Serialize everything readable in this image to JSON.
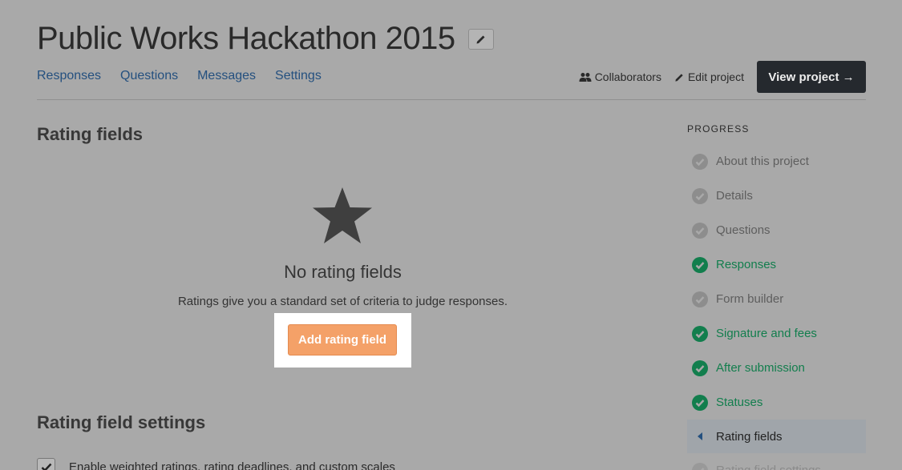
{
  "header": {
    "title": "Public Works Hackathon 2015",
    "nav": [
      {
        "label": "Responses"
      },
      {
        "label": "Questions"
      },
      {
        "label": "Messages"
      },
      {
        "label": "Settings"
      }
    ],
    "collaborators_label": "Collaborators",
    "edit_project_label": "Edit project",
    "view_project_label": "View project →"
  },
  "main": {
    "rating_fields_title": "Rating fields",
    "empty_title": "No rating fields",
    "empty_description": "Ratings give you a standard set of criteria to judge responses.",
    "add_button_label": "Add rating field",
    "settings_title": "Rating field settings",
    "weighted_checkbox_label": "Enable weighted ratings, rating deadlines, and custom scales"
  },
  "sidebar": {
    "heading": "PROGRESS",
    "items": [
      {
        "label": "About this project",
        "status": "pending"
      },
      {
        "label": "Details",
        "status": "pending"
      },
      {
        "label": "Questions",
        "status": "pending"
      },
      {
        "label": "Responses",
        "status": "done"
      },
      {
        "label": "Form builder",
        "status": "pending"
      },
      {
        "label": "Signature and fees",
        "status": "done"
      },
      {
        "label": "After submission",
        "status": "done"
      },
      {
        "label": "Statuses",
        "status": "done"
      },
      {
        "label": "Rating fields",
        "status": "current"
      },
      {
        "label": "Rating field settings",
        "status": "pending"
      }
    ]
  },
  "colors": {
    "overlay_bg": "#a9a9a9",
    "accent_orange": "#f4a168",
    "done_green": "#127e4d",
    "link_blue": "#24507f",
    "dark_button": "#25292e"
  }
}
